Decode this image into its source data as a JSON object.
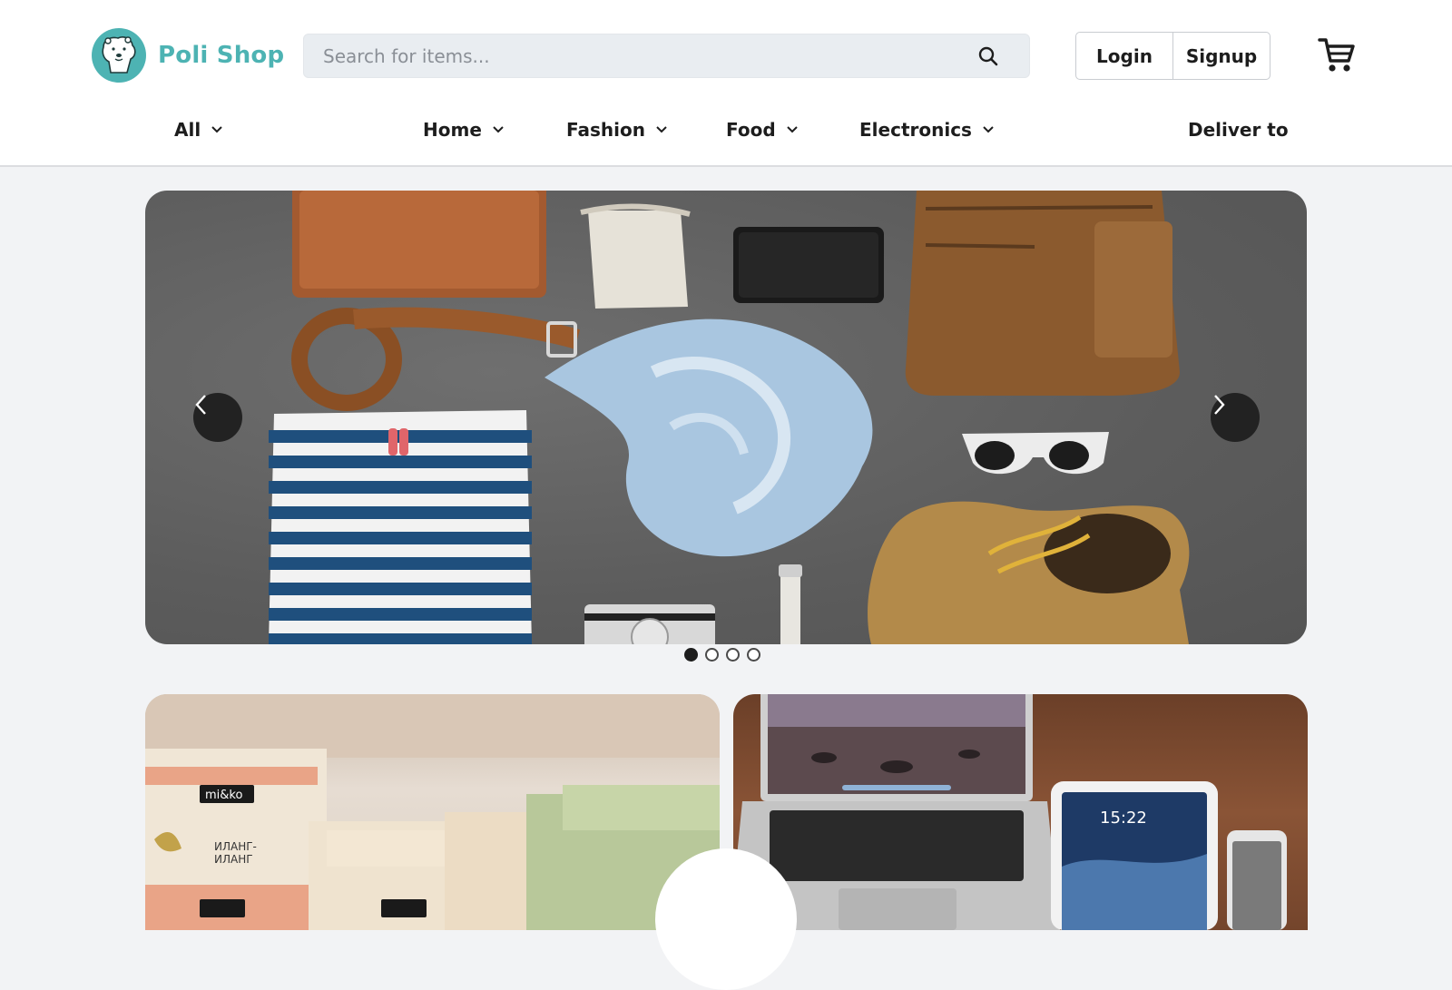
{
  "brand": {
    "name": "Poli Shop"
  },
  "search": {
    "placeholder": "Search for items...",
    "value": ""
  },
  "auth": {
    "login_label": "Login",
    "signup_label": "Signup"
  },
  "nav": {
    "all_label": "All",
    "items": [
      {
        "label": "Home"
      },
      {
        "label": "Fashion"
      },
      {
        "label": "Food"
      },
      {
        "label": "Electronics"
      }
    ],
    "deliver_label": "Deliver to"
  },
  "carousel": {
    "slide_count": 4,
    "active_slide": 1
  },
  "promo": {
    "soap_brand": "mi&ko",
    "soap_label_line1": "ИЛАНГ-",
    "soap_label_line2": "ИЛАНГ",
    "tablet_time": "15:22"
  },
  "icons": {
    "search": "search-icon",
    "cart": "cart-icon",
    "chevron": "chevron-down-icon",
    "prev": "chevron-left-icon",
    "next": "chevron-right-icon"
  },
  "colors": {
    "brand": "#4db3b3",
    "header_bg": "#ffffff",
    "page_bg": "#f2f3f5"
  }
}
